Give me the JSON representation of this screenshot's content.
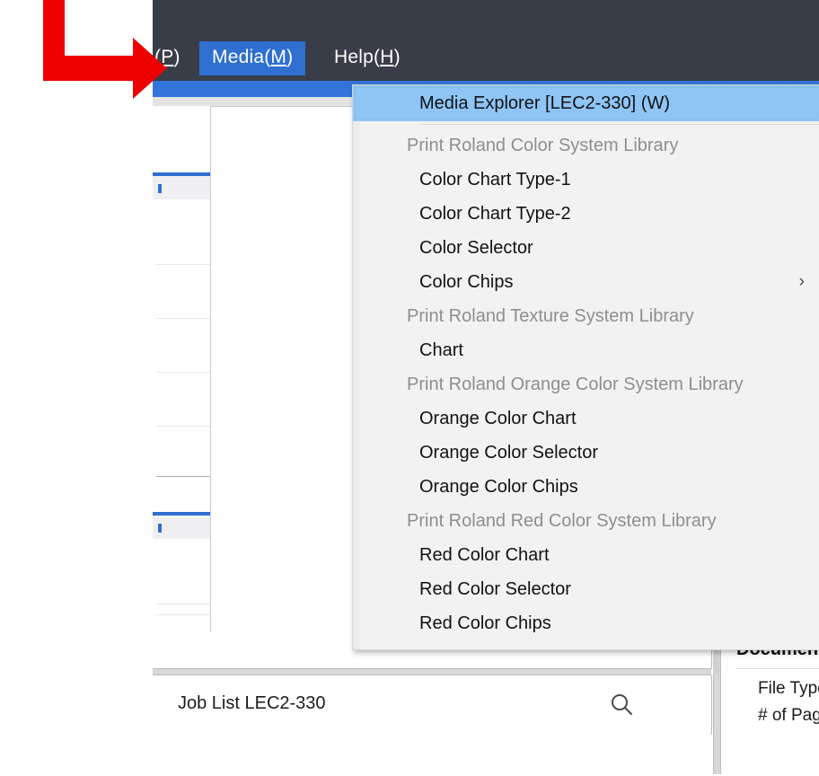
{
  "window": {
    "menubar": {
      "items": [
        {
          "label": "(P)",
          "mnemonic": "P",
          "active": false
        },
        {
          "label": "Media(M)",
          "mnemonic": "M",
          "active": true
        },
        {
          "label": "Help(H)",
          "mnemonic": "H",
          "active": false
        }
      ],
      "background_color": "#383d48",
      "active_item_color": "#2f6fd0"
    },
    "accent_color": "#3274d9"
  },
  "menu": {
    "name": "media-menu",
    "highlight_color": "#8ec5f6",
    "entries": [
      {
        "type": "item",
        "label": "Media Explorer [LEC2-330] (W)",
        "highlighted": true,
        "submenu": false
      },
      {
        "type": "separator"
      },
      {
        "type": "header",
        "label": "Print Roland Color System Library"
      },
      {
        "type": "item",
        "label": "Color Chart Type-1",
        "highlighted": false,
        "submenu": false
      },
      {
        "type": "item",
        "label": "Color Chart Type-2",
        "highlighted": false,
        "submenu": false
      },
      {
        "type": "item",
        "label": "Color Selector",
        "highlighted": false,
        "submenu": false
      },
      {
        "type": "item",
        "label": "Color Chips",
        "highlighted": false,
        "submenu": true,
        "submenu_glyph": "›"
      },
      {
        "type": "header",
        "label": "Print Roland Texture System Library"
      },
      {
        "type": "item",
        "label": "Chart",
        "highlighted": false,
        "submenu": false
      },
      {
        "type": "header",
        "label": "Print Roland Orange Color System Library"
      },
      {
        "type": "item",
        "label": "Orange Color Chart",
        "highlighted": false,
        "submenu": false
      },
      {
        "type": "item",
        "label": "Orange Color Selector",
        "highlighted": false,
        "submenu": false
      },
      {
        "type": "item",
        "label": "Orange Color Chips",
        "highlighted": false,
        "submenu": false
      },
      {
        "type": "header",
        "label": "Print Roland Red Color System Library"
      },
      {
        "type": "item",
        "label": "Red Color Chart",
        "highlighted": false,
        "submenu": false
      },
      {
        "type": "item",
        "label": "Red Color Selector",
        "highlighted": false,
        "submenu": false
      },
      {
        "type": "item",
        "label": "Red Color Chips",
        "highlighted": false,
        "submenu": false
      }
    ]
  },
  "joblist": {
    "label": "Job List LEC2-330",
    "search_icon": "search-icon"
  },
  "document_information": {
    "title": "Document Informatio",
    "fields": [
      {
        "label": "File Type"
      },
      {
        "label": "# of Pages"
      }
    ]
  },
  "annotation": {
    "arrow_color": "#ee0000",
    "shape": "elbow-arrow-right"
  }
}
